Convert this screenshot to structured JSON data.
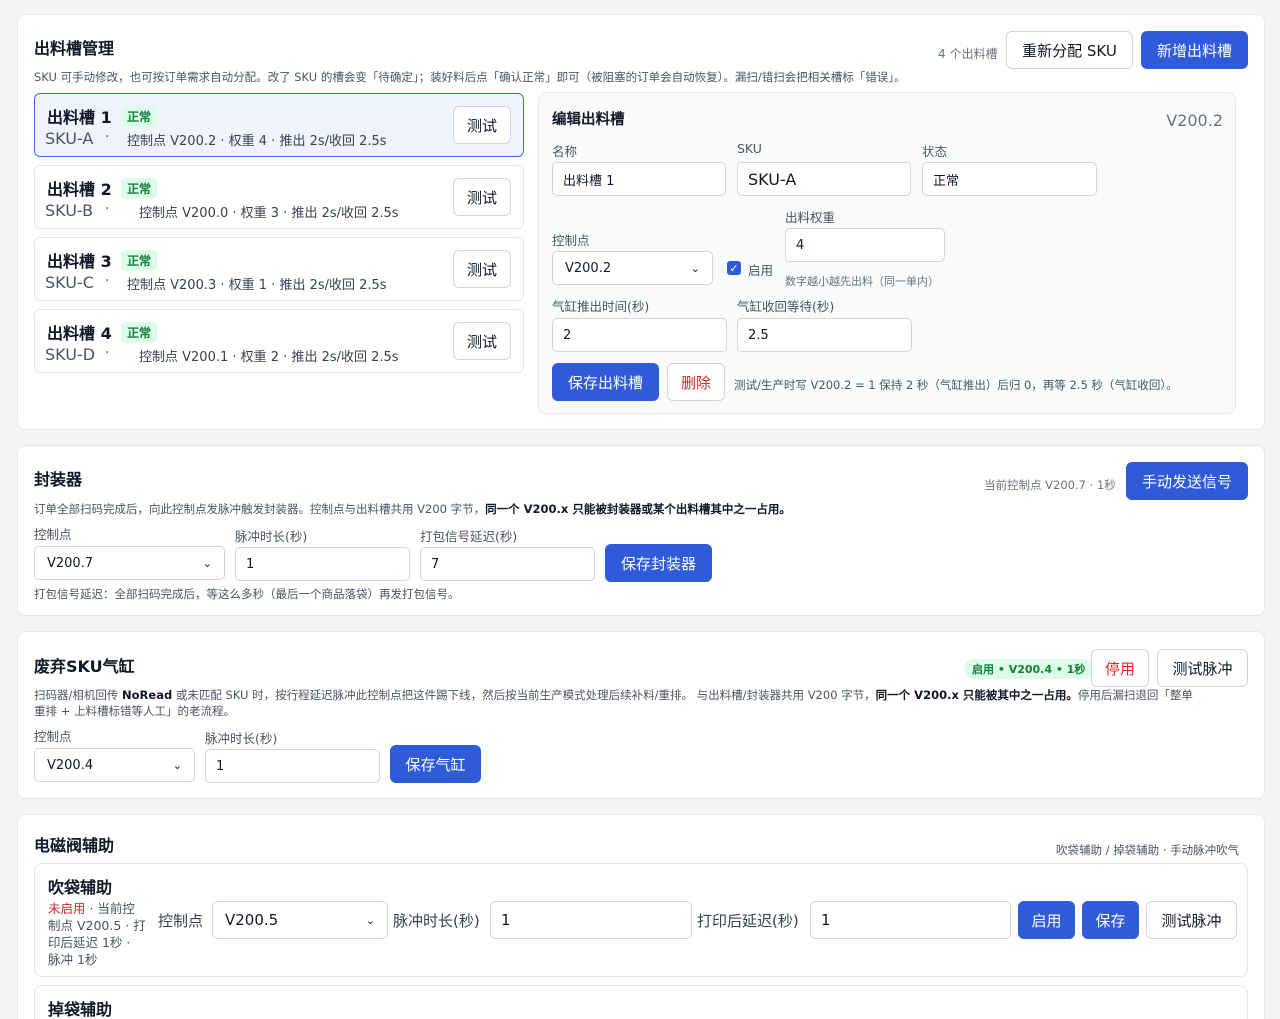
{
  "slots_section": {
    "title": "出料槽管理",
    "count_text": "4 个出料槽",
    "reassign_label": "重新分配 SKU",
    "add_label": "新增出料槽",
    "desc": "SKU 可手动修改，也可按订单需求自动分配。改了 SKU 的槽会变「待确定」；装好料后点「确认正常」即可（被阻塞的订单会自动恢复）。漏扫/错扫会把相关槽标「错误」。",
    "slots": [
      {
        "name": "出料槽 1",
        "status": "正常",
        "sku": "SKU-A",
        "dot": "·",
        "info": "控制点 V200.2 · 权重 4 · 推出 2s/收回 2.5s",
        "test": "测试"
      },
      {
        "name": "出料槽 2",
        "status": "正常",
        "sku": "SKU-B",
        "dot": "·",
        "info": "控制点 V200.0 · 权重 3 · 推出 2s/收回 2.5s",
        "test": "测试"
      },
      {
        "name": "出料槽 3",
        "status": "正常",
        "sku": "SKU-C",
        "dot": "·",
        "info": "控制点 V200.3 · 权重 1 · 推出 2s/收回 2.5s",
        "test": "测试"
      },
      {
        "name": "出料槽 4",
        "status": "正常",
        "sku": "SKU-D",
        "dot": "·",
        "info": "控制点 V200.1 · 权重 2 · 推出 2s/收回 2.5s",
        "test": "测试"
      }
    ],
    "edit": {
      "title": "编辑出料槽",
      "address": "V200.2",
      "name_label": "名称",
      "name_value": "出料槽 1",
      "sku_label": "SKU",
      "sku_value": "SKU-A",
      "state_label": "状态",
      "state_value": "正常",
      "control_label": "控制点",
      "control_value": "V200.2",
      "enable_label": "启用",
      "weight_label": "出料权重",
      "weight_value": "4",
      "weight_hint": "数字越小越先出料（同一单内）",
      "push_label": "气缸推出时间(秒)",
      "push_value": "2",
      "retract_label": "气缸收回等待(秒)",
      "retract_value": "2.5",
      "save_label": "保存出料槽",
      "delete_label": "删除",
      "hint": "测试/生产时写 V200.2 = 1 保持 2 秒（气缸推出）后归 0，再等 2.5 秒（气缸收回）。"
    }
  },
  "sealer": {
    "title": "封装器",
    "current": "当前控制点 V200.7 · 1秒",
    "send_label": "手动发送信号",
    "desc_a": "订单全部扫码完成后，向此控制点发脉冲触发封装器。控制点与出料槽共用 V200 字节，",
    "desc_b": "同一个 V200.x 只能被封装器或某个出料槽其中之一占用。",
    "control_label": "控制点",
    "control_value": "V200.7",
    "pulse_label": "脉冲时长(秒)",
    "pulse_value": "1",
    "delay_label": "打包信号延迟(秒)",
    "delay_value": "7",
    "save_label": "保存封装器",
    "hint": "打包信号延迟：全部扫码完成后，等这么多秒（最后一个商品落袋）再发打包信号。"
  },
  "reject": {
    "title": "废弃SKU气缸",
    "pill": "启用 • V200.4 • 1秒",
    "disable_label": "停用",
    "test_label": "测试脉冲",
    "desc_line1_a": "扫码器/相机回传 ",
    "desc_line1_b": "NoRead",
    "desc_line1_c": " 或未匹配 SKU 时，按行程延迟脉冲此控制点把这件踢下线，然后按当前生产模式处理后续补料/重排。 与出料槽/封装器共用 V200 字节，",
    "desc_line1_d": "同一个 V200.x 只能被其中之一占用。",
    "desc_line1_e": "停用后漏扫退回「整单",
    "desc_line2": "重排 + 上料槽标错等人工」的老流程。",
    "control_label": "控制点",
    "control_value": "V200.4",
    "pulse_label": "脉冲时长(秒)",
    "pulse_value": "1",
    "save_label": "保存气缸"
  },
  "valve": {
    "title": "电磁阀辅助",
    "right_text": "吹袋辅助 / 掉袋辅助 · 手动脉冲吹气",
    "blow": {
      "title": "吹袋辅助",
      "status": "未启用",
      "status_rest": " · 当前控",
      "line2": "制点 V200.5 · 打",
      "line3": "印后延迟 1秒 ·",
      "line4": "脉冲 1秒",
      "control_label": "控制点",
      "control_value": "V200.5",
      "pulse_label": "脉冲时长(秒)",
      "pulse_value": "1",
      "delay_label": "打印后延迟(秒)",
      "delay_value": "1",
      "enable_label": "启用",
      "save_label": "保存",
      "test_label": "测试脉冲"
    },
    "drop": {
      "title": "掉袋辅助"
    }
  }
}
